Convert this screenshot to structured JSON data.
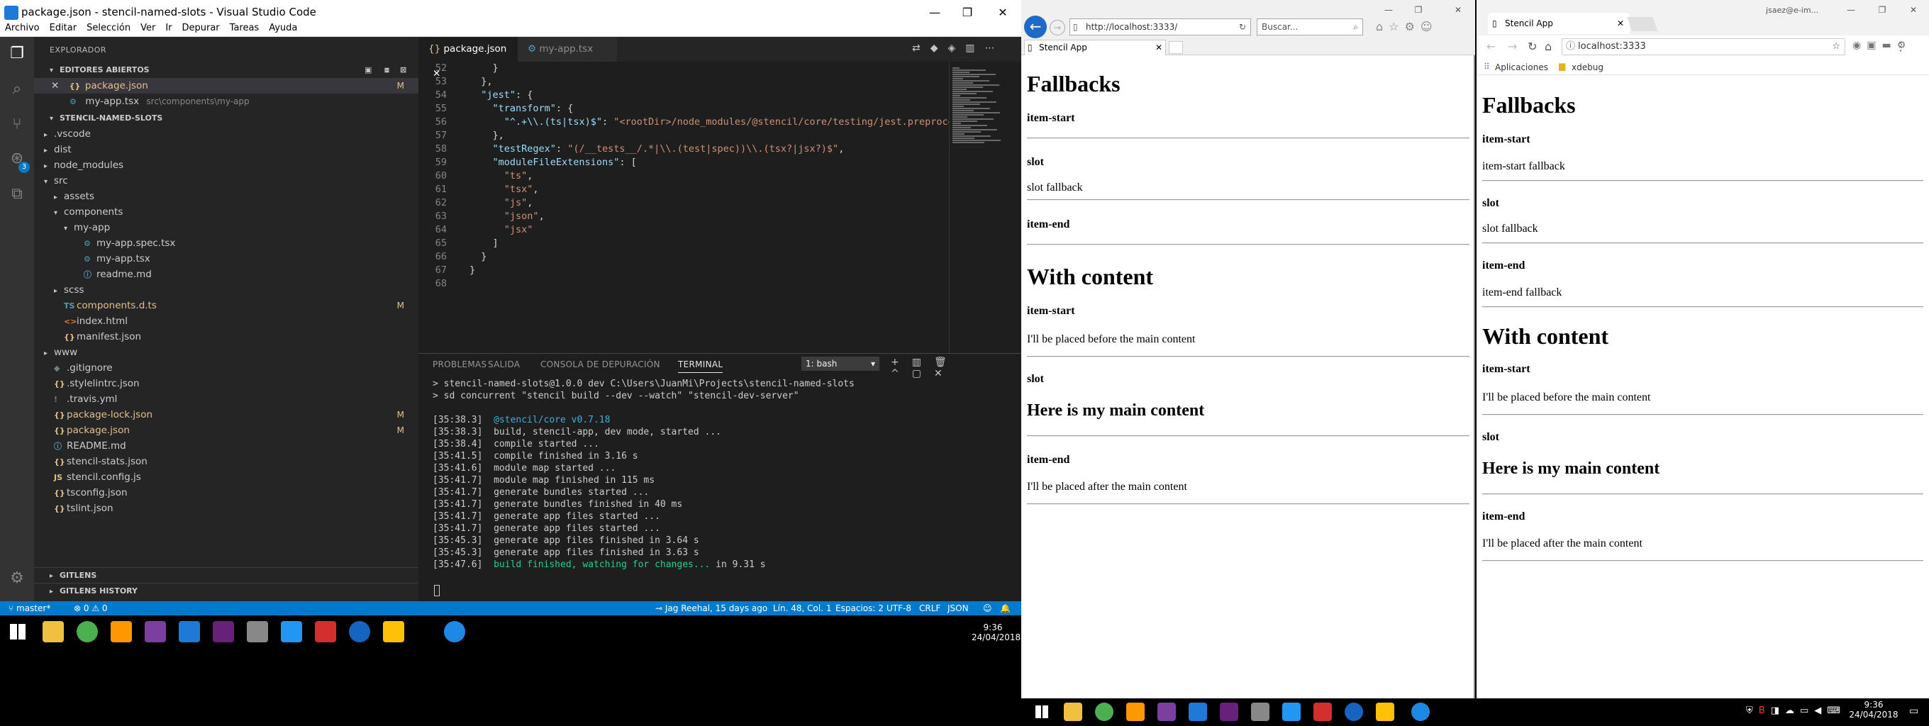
{
  "vscode": {
    "title": "package.json - stencil-named-slots - Visual Studio Code",
    "menu": [
      "Archivo",
      "Editar",
      "Selección",
      "Ver",
      "Ir",
      "Depurar",
      "Tareas",
      "Ayuda"
    ],
    "explorer_title": "EXPLORADOR",
    "open_editors_title": "EDITORES ABIERTOS",
    "open_editors": [
      {
        "name": "package.json",
        "status": "M"
      },
      {
        "name": "my-app.tsx",
        "path": "src\\components\\my-app"
      }
    ],
    "project_title": "STENCIL-NAMED-SLOTS",
    "tree": [
      {
        "name": ".vscode",
        "type": "folder",
        "depth": 0
      },
      {
        "name": "dist",
        "type": "folder",
        "depth": 0
      },
      {
        "name": "node_modules",
        "type": "folder",
        "depth": 0
      },
      {
        "name": "src",
        "type": "folder-open",
        "depth": 0
      },
      {
        "name": "assets",
        "type": "folder",
        "depth": 1
      },
      {
        "name": "components",
        "type": "folder-open",
        "depth": 1
      },
      {
        "name": "my-app",
        "type": "folder-open",
        "depth": 2
      },
      {
        "name": "my-app.spec.tsx",
        "type": "tsx",
        "depth": 3
      },
      {
        "name": "my-app.tsx",
        "type": "tsx",
        "depth": 3
      },
      {
        "name": "readme.md",
        "type": "md",
        "depth": 3
      },
      {
        "name": "scss",
        "type": "folder",
        "depth": 1
      },
      {
        "name": "components.d.ts",
        "type": "ts",
        "depth": 1,
        "status": "M"
      },
      {
        "name": "index.html",
        "type": "html",
        "depth": 1
      },
      {
        "name": "manifest.json",
        "type": "json",
        "depth": 1
      },
      {
        "name": "www",
        "type": "folder",
        "depth": 0
      },
      {
        "name": ".gitignore",
        "type": "git",
        "depth": 0
      },
      {
        "name": ".stylelintrc.json",
        "type": "json",
        "depth": 0
      },
      {
        "name": ".travis.yml",
        "type": "yml",
        "depth": 0
      },
      {
        "name": "package-lock.json",
        "type": "json",
        "depth": 0,
        "status": "M"
      },
      {
        "name": "package.json",
        "type": "json",
        "depth": 0,
        "status": "M"
      },
      {
        "name": "README.md",
        "type": "md",
        "depth": 0
      },
      {
        "name": "stencil-stats.json",
        "type": "json",
        "depth": 0
      },
      {
        "name": "stencil.config.js",
        "type": "js",
        "depth": 0
      },
      {
        "name": "tsconfig.json",
        "type": "json",
        "depth": 0
      },
      {
        "name": "tslint.json",
        "type": "json",
        "depth": 0
      }
    ],
    "bottom_sections": [
      "GITLENS",
      "GITLENS HISTORY"
    ],
    "tabs": [
      {
        "label": "package.json",
        "active": true
      },
      {
        "label": "my-app.tsx",
        "active": false
      }
    ],
    "code": [
      {
        "n": "52",
        "html": "    <span class=\"p\">}</span>"
      },
      {
        "n": "53",
        "html": "  <span class=\"p\">},</span>"
      },
      {
        "n": "54",
        "html": "  <span class=\"k\">\"jest\"</span><span class=\"p\">: {</span>"
      },
      {
        "n": "55",
        "html": "    <span class=\"k\">\"transform\"</span><span class=\"p\">: {</span>"
      },
      {
        "n": "56",
        "html": "      <span class=\"k\">\"^.+\\\\.(ts|tsx)$\"</span><span class=\"p\">: </span><span class=\"s\">\"&lt;rootDir&gt;/node_modules/@stencil/core/testing/jest.preprocessor</span>"
      },
      {
        "n": "57",
        "html": "    <span class=\"p\">},</span>"
      },
      {
        "n": "58",
        "html": "    <span class=\"k\">\"testRegex\"</span><span class=\"p\">: </span><span class=\"s\">\"(/__tests__/.*|\\\\.(test|spec))\\\\.(tsx?|jsx?)$\"</span><span class=\"p\">,</span>"
      },
      {
        "n": "59",
        "html": "    <span class=\"k\">\"moduleFileExtensions\"</span><span class=\"p\">: [</span>"
      },
      {
        "n": "60",
        "html": "      <span class=\"s\">\"ts\"</span><span class=\"p\">,</span>"
      },
      {
        "n": "61",
        "html": "      <span class=\"s\">\"tsx\"</span><span class=\"p\">,</span>"
      },
      {
        "n": "62",
        "html": "      <span class=\"s\">\"js\"</span><span class=\"p\">,</span>"
      },
      {
        "n": "63",
        "html": "      <span class=\"s\">\"json\"</span><span class=\"p\">,</span>"
      },
      {
        "n": "64",
        "html": "      <span class=\"s\">\"jsx\"</span>"
      },
      {
        "n": "65",
        "html": "    <span class=\"p\">]</span>"
      },
      {
        "n": "66",
        "html": "  <span class=\"p\">}</span>"
      },
      {
        "n": "67",
        "html": "<span class=\"p\">}</span>"
      },
      {
        "n": "68",
        "html": ""
      }
    ],
    "panel_tabs": [
      "PROBLEMAS",
      "SALIDA",
      "CONSOLA DE DEPURACIÓN",
      "TERMINAL"
    ],
    "terminal_select": "1: bash",
    "terminal": [
      {
        "t": "> stencil-named-slots@1.0.0 dev C:\\Users\\JuanMi\\Projects\\stencil-named-slots",
        "c": ""
      },
      {
        "t": "> sd concurrent \"stencil build --dev --watch\" \"stencil-dev-server\"",
        "c": ""
      },
      {
        "t": "",
        "c": ""
      },
      {
        "t": "[35:38.3]  ",
        "c2": "@stencil/core v0.7.18",
        "c": "cyan"
      },
      {
        "t": "[35:38.3]  build, stencil-app, dev mode, started ...",
        "c": ""
      },
      {
        "t": "[35:38.4]  compile started ...",
        "c": ""
      },
      {
        "t": "[35:41.5]  compile finished in 3.16 s",
        "c": ""
      },
      {
        "t": "[35:41.6]  module map started ...",
        "c": ""
      },
      {
        "t": "[35:41.7]  module map finished in 115 ms",
        "c": ""
      },
      {
        "t": "[35:41.7]  generate bundles started ...",
        "c": ""
      },
      {
        "t": "[35:41.7]  generate bundles finished in 40 ms",
        "c": ""
      },
      {
        "t": "[35:41.7]  generate app files started ...",
        "c": ""
      },
      {
        "t": "[35:41.7]  generate app files started ...",
        "c": ""
      },
      {
        "t": "[35:45.3]  generate app files finished in 3.64 s",
        "c": ""
      },
      {
        "t": "[35:45.3]  generate app files finished in 3.63 s",
        "c": ""
      },
      {
        "t": "[35:47.6]  ",
        "c2": "build finished, watching for changes...",
        "c3": " in 9.31 s",
        "c": "grn"
      }
    ],
    "status": {
      "branch": "master*",
      "errors": "⊗ 0 ⚠ 0",
      "blame": "Jag Reehal, 15 days ago",
      "position": "Lín. 48, Col. 1",
      "spaces": "Espacios: 2",
      "encoding": "UTF-8",
      "eol": "CRLF",
      "lang": "JSON"
    }
  },
  "taskbar": {
    "time": "9:36",
    "date": "24/04/2018"
  },
  "ie": {
    "url": "http://localhost:3333/",
    "search_placeholder": "Buscar...",
    "tab_title": "Stencil App"
  },
  "chrome": {
    "tab_title": "Stencil App",
    "url": "localhost:3333",
    "bookmarks": [
      "Aplicaciones",
      "xdebug"
    ],
    "user": "jsaez@e-im..."
  },
  "page": {
    "fallbacks": "Fallbacks",
    "item_start": "item-start",
    "slot": "slot",
    "item_end": "item-end",
    "item_start_fallback": "item-start fallback",
    "slot_fallback": "slot fallback",
    "item_end_fallback": "item-end fallback",
    "with_content": "With content",
    "before": "I'll be placed before the main content",
    "main": "Here is my main content",
    "after": "I'll be placed after the main content"
  }
}
